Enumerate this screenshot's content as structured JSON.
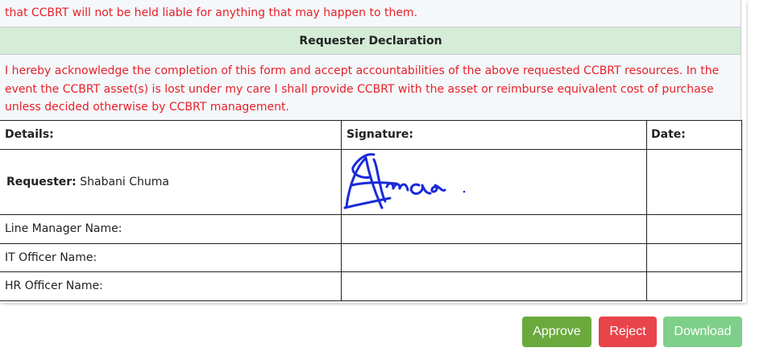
{
  "top_notice": "that CCBRT will not be held liable for anything that may happen to them.",
  "declaration": {
    "title": "Requester Declaration",
    "text": "I hereby acknowledge the completion of this form and accept accountabilities of the above requested CCBRT resources. In the event the CCBRT asset(s) is lost under my care I shall provide CCBRT with the asset or reimburse equivalent cost of purchase unless decided otherwise by CCBRT management."
  },
  "table": {
    "headers": {
      "details": "Details:",
      "signature": "Signature:",
      "date": "Date:"
    },
    "requester_label": "Requester:",
    "requester_name": "Shabani Chuma",
    "rows": [
      {
        "label": "Line Manager Name:"
      },
      {
        "label": "IT Officer Name:"
      },
      {
        "label": "HR Officer Name:"
      }
    ]
  },
  "buttons": {
    "approve": "Approve",
    "reject": "Reject",
    "download": "Download"
  },
  "colors": {
    "accent_red": "#e8202a",
    "header_green": "#d5ecd7",
    "approve": "#6aaa3d",
    "reject": "#e8444a",
    "download": "#7ecf8a",
    "signature_ink": "#1a2ad8"
  }
}
